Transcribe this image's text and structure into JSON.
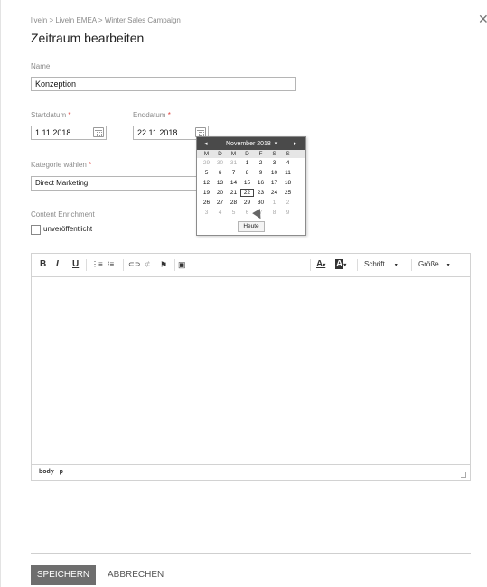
{
  "breadcrumb": "liveln > Liveln EMEA > Winter Sales Campaign",
  "title": "Zeitraum bearbeiten",
  "name": {
    "label": "Name",
    "value": "Konzeption"
  },
  "start": {
    "label": "Startdatum",
    "value": "1.11.2018"
  },
  "end": {
    "label": "Enddatum",
    "value": "22.11.2018"
  },
  "required_mark": "*",
  "category": {
    "label": "Kategorie wählen",
    "value": "Direct Marketing"
  },
  "enrichment": {
    "label": "Content Enrichment",
    "checkbox_label": "unveröffentlicht",
    "checked": false
  },
  "toolbar": {
    "bold": "B",
    "italic": "I",
    "underline": "U",
    "ol": "⋮≡",
    "ul": "⁝≡",
    "link": "⊂⊃",
    "unlink": "⊄",
    "anchor": "⚑",
    "image": "▣",
    "textcolor": "A",
    "bgcolor": "A",
    "dd_arrow": "▾",
    "font": "Schrift...",
    "size": "Größe"
  },
  "statusbar": {
    "path1": "body",
    "path2": "p"
  },
  "footer": {
    "save": "SPEICHERN",
    "cancel": "ABBRECHEN"
  },
  "datepicker": {
    "month": "November 2018",
    "prev": "◂",
    "next": "▸",
    "month_arrow": "▾",
    "weekdays": [
      "M",
      "D",
      "M",
      "D",
      "F",
      "S",
      "S"
    ],
    "weeks": [
      [
        "29",
        "30",
        "31",
        "1",
        "2",
        "3",
        "4"
      ],
      [
        "5",
        "6",
        "7",
        "8",
        "9",
        "10",
        "11"
      ],
      [
        "12",
        "13",
        "14",
        "15",
        "16",
        "17",
        "18"
      ],
      [
        "19",
        "20",
        "21",
        "22",
        "23",
        "24",
        "25"
      ],
      [
        "26",
        "27",
        "28",
        "29",
        "30",
        "1",
        "2"
      ],
      [
        "3",
        "4",
        "5",
        "6",
        "7",
        "8",
        "9"
      ]
    ],
    "today": "Heute",
    "selected": "22"
  },
  "icons": {
    "close": "close-icon",
    "calendar": "calendar-icon"
  },
  "colors": {
    "save_bg": "#6e6e6e",
    "datepicker_header": "#4a4a4a",
    "required": "#e0403c"
  }
}
